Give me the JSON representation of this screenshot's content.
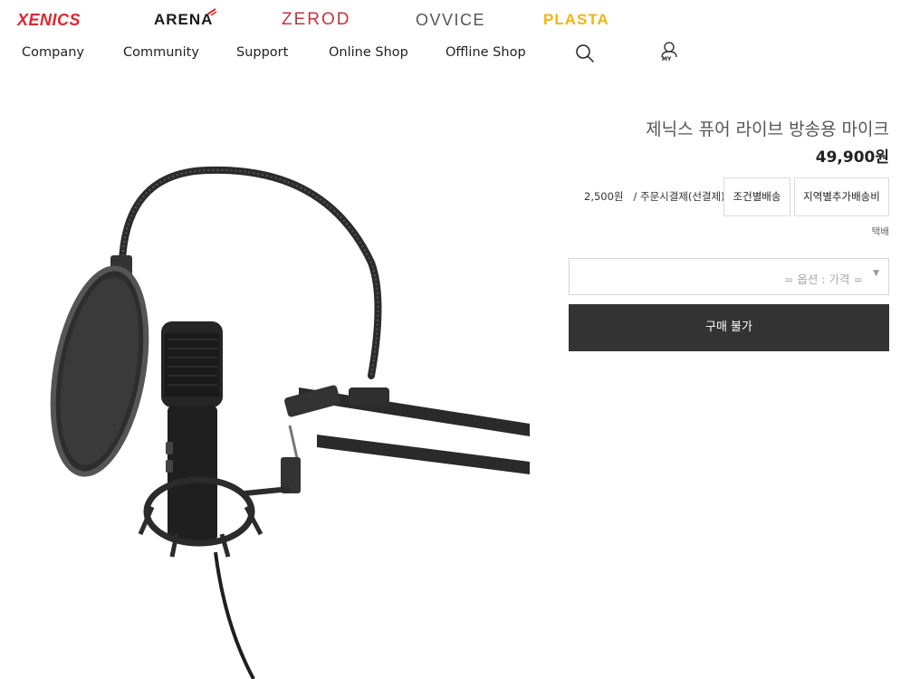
{
  "brands": {
    "xenics": "XENICS",
    "arena": "ARENA",
    "zerod": "ZEROD",
    "ovvice": "OVVICE",
    "plasta": "PLASTA"
  },
  "nav": {
    "items": [
      "Company",
      "Community",
      "Support",
      "Online Shop",
      "Offline Shop"
    ],
    "my_label": "MY"
  },
  "product": {
    "title": "제닉스 퓨어 라이브 방송용 마이크",
    "price": "49,900원",
    "shipping": {
      "fee": "2,500원",
      "payment": "/ 주문시결제(선결제)",
      "conditional_button": "조건별배송",
      "regional_button": "지역별추가배송비",
      "method": "택배"
    },
    "option_placeholder": "= 옵션 : 가격 =",
    "buy_button": "구매 불가"
  },
  "colors": {
    "xenics": "#e0262f",
    "zerod": "#c2353f",
    "plasta": "#f2b70d",
    "buy_button_bg": "#333333"
  },
  "icons": {
    "search": "search-icon",
    "my": "user-icon",
    "dropdown": "dropdown-arrow-icon"
  }
}
